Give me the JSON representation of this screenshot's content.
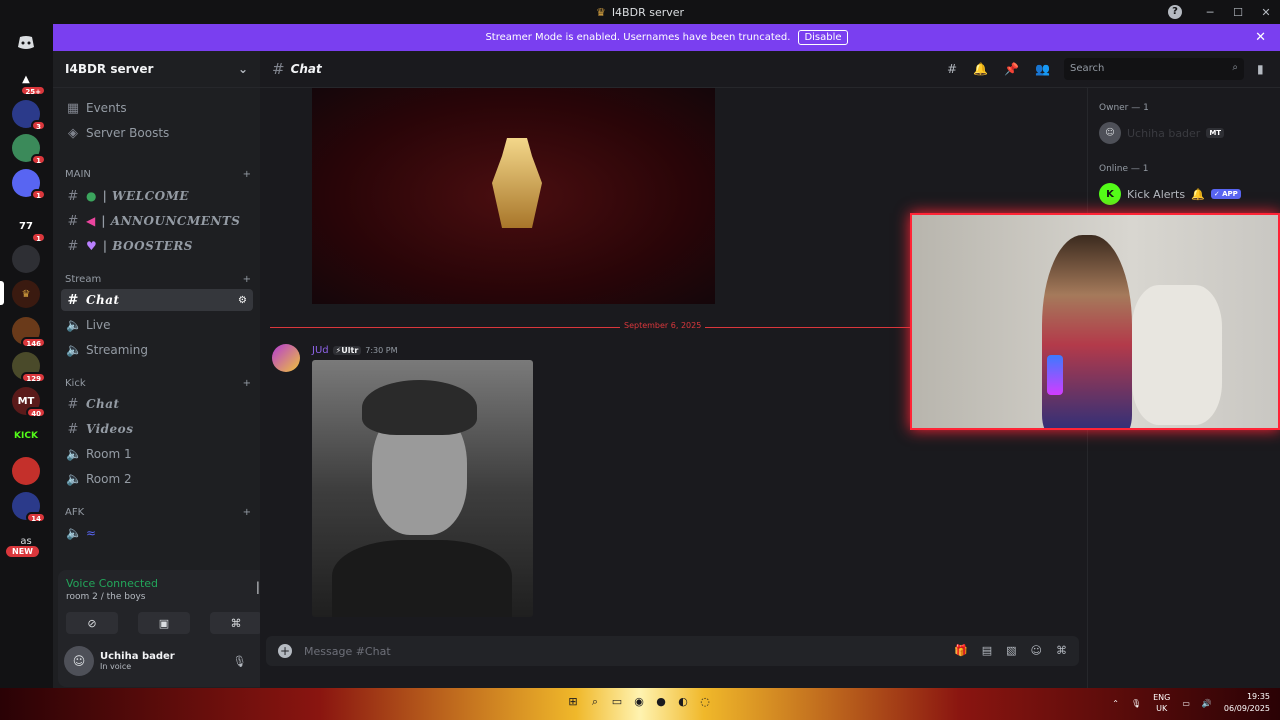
{
  "app": {
    "window_title": "I4BDR server",
    "help_glyph": "?"
  },
  "window_controls": {
    "minimize": "─",
    "maximize": "☐",
    "close": "✕"
  },
  "banner": {
    "text": "Streamer Mode is enabled. Usernames have been truncated.",
    "button": "Disable"
  },
  "guild_badges": [
    "25+",
    "3",
    "1",
    "1",
    "1",
    "146",
    "129",
    "40",
    "14"
  ],
  "guild_labels": {
    "kick": "KICK",
    "as": "as",
    "new": "NEW",
    "mt": "MT",
    "seventy_seven": "77"
  },
  "server": {
    "name": "I4BDR server"
  },
  "top_items": [
    {
      "label": "Events"
    },
    {
      "label": "Server Boosts"
    }
  ],
  "categories": {
    "main": "MAIN",
    "stream": "Stream",
    "kick": "Kick",
    "afk": "AFK"
  },
  "channels": {
    "welcome": "| WELCOME",
    "announcments": "| ANNOUNCMENTS",
    "boosters": "| BOOSTERS",
    "chat": "Chat",
    "live": "Live",
    "streaming": "Streaming",
    "kick_chat": "Chat",
    "videos": "Videos",
    "room1": "Room 1",
    "room2": "Room 2"
  },
  "voice": {
    "status": "Voice Connected",
    "room": "room 2 / the boys"
  },
  "user": {
    "name": "Uchiha bader",
    "status": "In voice"
  },
  "header": {
    "channel": "Chat",
    "search_placeholder": "Search"
  },
  "message": {
    "date": "September 6, 2025",
    "author": "JUd",
    "tag": "Ultr",
    "time": "7:30 PM"
  },
  "composer": {
    "placeholder": "Message #Chat"
  },
  "members": {
    "owner_header": "Owner — 1",
    "owner_name": "Uchiha bader",
    "owner_tag": "MT",
    "online_header": "Online — 1",
    "online_name": "Kick Alerts",
    "online_tag": "✓ APP"
  },
  "taskbar": {
    "lang_top": "ENG",
    "lang_bottom": "UK",
    "time": "19:35",
    "date": "06/09/2025"
  },
  "colors": {
    "accent": "#7a3ff0",
    "danger": "#da373c",
    "online": "#23a55a",
    "brand": "#5865f2"
  }
}
